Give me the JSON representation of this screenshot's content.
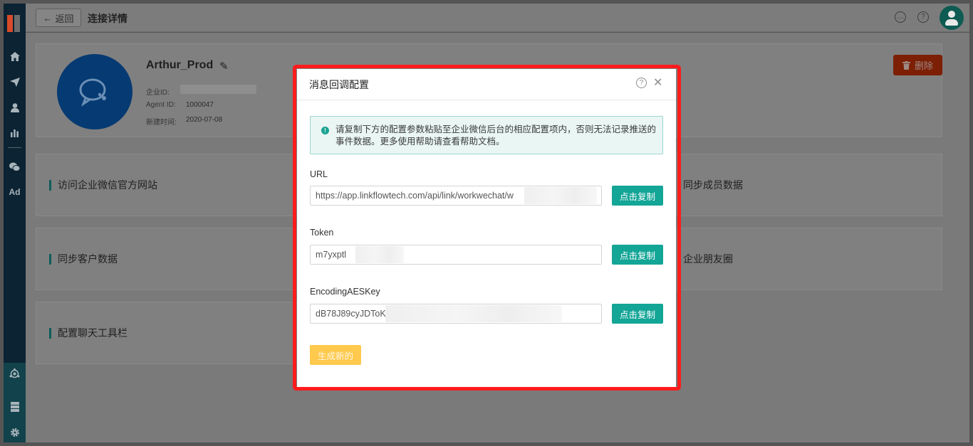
{
  "topbar": {
    "back_label": "返回",
    "title": "连接详情"
  },
  "sidebar": {
    "items": [
      {
        "icon": "home-icon"
      },
      {
        "icon": "send-icon"
      },
      {
        "icon": "user-icon"
      },
      {
        "icon": "chart-icon"
      },
      {
        "icon": "wechat-icon"
      },
      {
        "icon": "ad-icon",
        "label": "Ad"
      },
      {
        "icon": "hub-icon"
      },
      {
        "icon": "server-icon"
      },
      {
        "icon": "gear-icon"
      }
    ]
  },
  "profile": {
    "name": "Arthur_Prod",
    "corp_id_label": "企业ID:",
    "agent_id_label": "Agent ID:",
    "agent_id": "1000047",
    "created_label": "新建时间:",
    "created": "2020-07-08",
    "delete_label": "删除"
  },
  "features": [
    "访问企业微信官方网站",
    "同步成员数据",
    "同步客户数据",
    "企业朋友圈",
    "配置聊天工具栏"
  ],
  "modal": {
    "title": "消息回调配置",
    "notice": "请复制下方的配置参数粘贴至企业微信后台的相应配置项内，否则无法记录推送的事件数据。更多使用帮助请查看帮助文档。",
    "url_label": "URL",
    "url_value": "https://app.linkflowtech.com/api/link/workwechat/w",
    "token_label": "Token",
    "token_value": "m7yxptl",
    "aes_label": "EncodingAESKey",
    "aes_value": "dB78J89cyJDToK0",
    "copy_label": "点击复制",
    "generate_label": "生成新的"
  },
  "colors": {
    "accent": "#13a596",
    "sidebar": "#0b2333",
    "highlight": "#ff1c1c",
    "delete": "#7c1f05",
    "generate": "#ffc94d"
  }
}
